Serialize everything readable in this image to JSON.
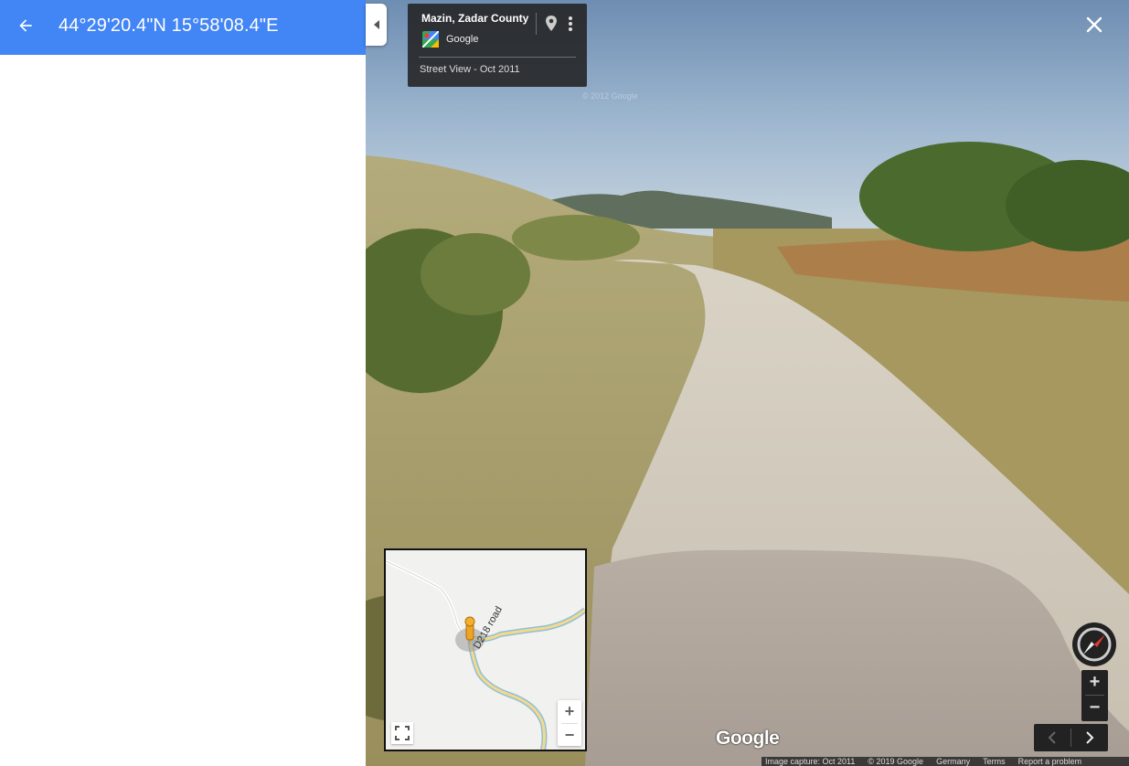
{
  "header": {
    "coordinates": "44°29'20.4\"N 15°58'08.4\"E",
    "back_icon": "arrow-back-icon",
    "color": "#4285f4"
  },
  "info_card": {
    "place_name": "Mazin, Zadar County",
    "provider": "Google",
    "street_view_date": "Street View - Oct 2011",
    "pin_icon": "location-pin-icon",
    "more_icon": "more-vert-icon"
  },
  "street_view": {
    "faint_copyright": "© 2012 Google",
    "logo": "Google"
  },
  "minimap": {
    "road_label": "D218 road",
    "zoom_in": "+",
    "zoom_out": "−"
  },
  "controls": {
    "zoom_in": "+",
    "zoom_out": "−",
    "close_icon": "close-icon",
    "compass_icon": "compass-icon"
  },
  "footer": {
    "image_capture": "Image capture: Oct 2011",
    "copyright": "© 2019 Google",
    "region": "Germany",
    "terms": "Terms",
    "report": "Report a problem"
  }
}
